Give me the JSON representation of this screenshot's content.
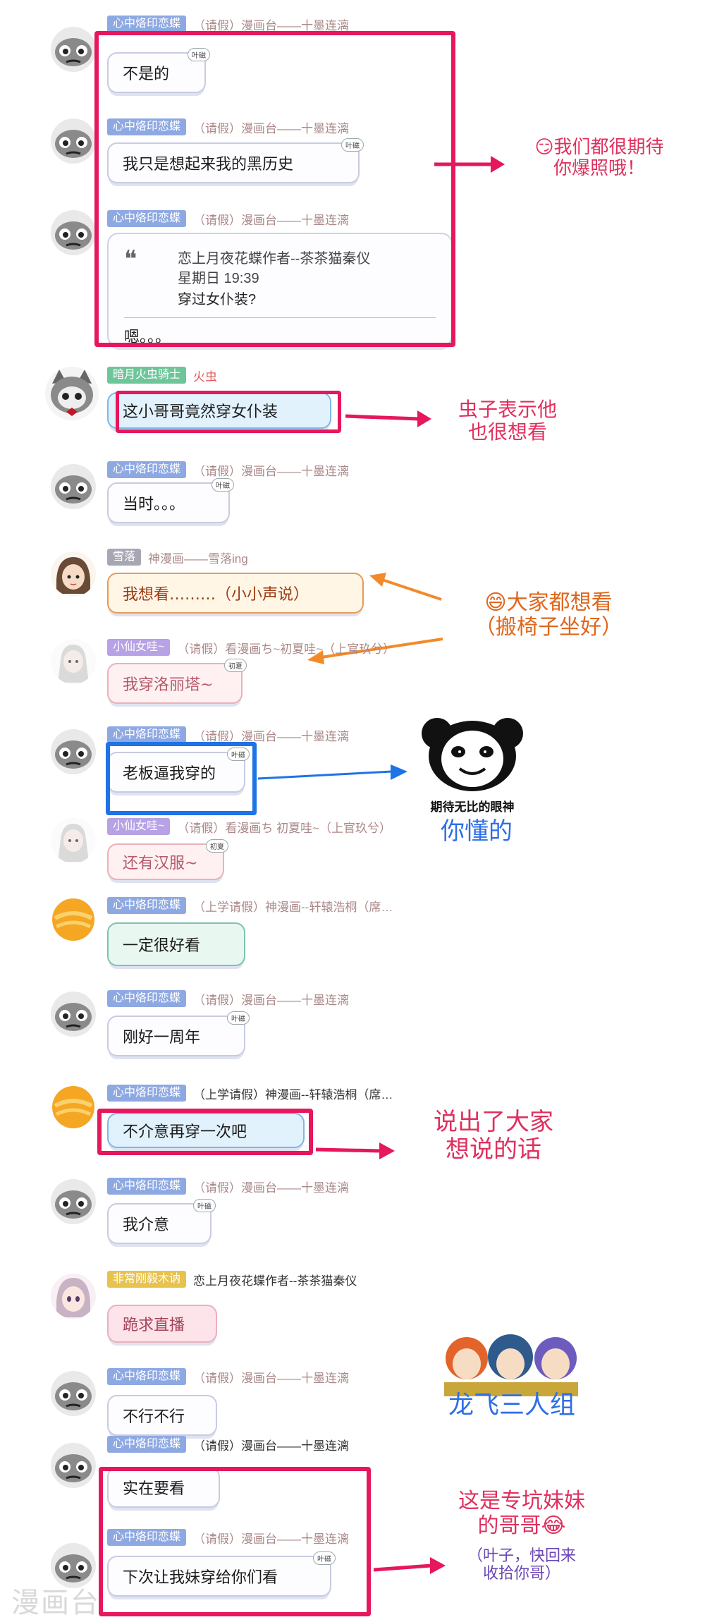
{
  "user_main": {
    "badge": "心中烙印恋蝶",
    "sub_a": "（请假）漫画台——十墨连漓",
    "sub_b": "（上学请假）神漫画--轩辕浩桐（席…"
  },
  "messages": [
    {
      "text": "不是的"
    },
    {
      "text": "我只是想起来我的黑历史"
    },
    {
      "quote": {
        "name": "恋上月夜花蝶作者--茶茶猫秦仪",
        "time": "星期日 19:39",
        "text": "穿过女仆装?"
      },
      "reply": "嗯。。。"
    },
    {
      "badge": "暗月火虫骑士",
      "sub": "火虫",
      "text": "这小哥哥竟然穿女仆装"
    },
    {
      "text": "当时。。。"
    },
    {
      "badge": "雪落",
      "sub": "神漫画——雪落ing",
      "text": "我想看………（小小声说）"
    },
    {
      "badge": "小仙女哇~",
      "sub": "（请假）看漫画ち~初夏哇~（上官玖兮）",
      "text": "我穿洛丽塔~"
    },
    {
      "text": "老板逼我穿的"
    },
    {
      "badge": "小仙女哇~",
      "sub": "（请假）看漫画ち 初夏哇~（上官玖兮）",
      "text": "还有汉服~"
    },
    {
      "text": "一定很好看"
    },
    {
      "text": "刚好一周年"
    },
    {
      "text": "不介意再穿一次吧"
    },
    {
      "text": "我介意"
    },
    {
      "badge": "非常刚毅木讷",
      "sub": "恋上月夜花蝶作者--茶茶猫秦仪",
      "text": "跪求直播"
    },
    {
      "text": "不行不行"
    },
    {
      "text": "实在要看"
    },
    {
      "text": "下次让我妹穿给你们看"
    }
  ],
  "bubble_badge": "叶磁",
  "bubble_badge_alt": "初夏",
  "annotations": {
    "a1": [
      "😏我们都很期待",
      "你爆照哦！"
    ],
    "a2": [
      "虫子表示他",
      "也很想看"
    ],
    "a3": [
      "😄大家都想看",
      "（搬椅子坐好）"
    ],
    "a4_caption": "期待无比的眼神",
    "a4": "你懂的",
    "a5": [
      "说出了大家",
      "想说的话"
    ],
    "a6": "龙飞三人组",
    "a7": [
      "这是专坑妹妹",
      "的哥哥😂"
    ],
    "a7_sub": [
      "（叶子，快回来",
      "收拾你哥）"
    ]
  },
  "watermark": "漫画台",
  "colors": {
    "highlight_red": "#e6175d",
    "highlight_blue": "#1e73e6",
    "note_red": "#e0305e",
    "note_orange": "#e0661b",
    "note_blue": "#2e6ee6"
  }
}
